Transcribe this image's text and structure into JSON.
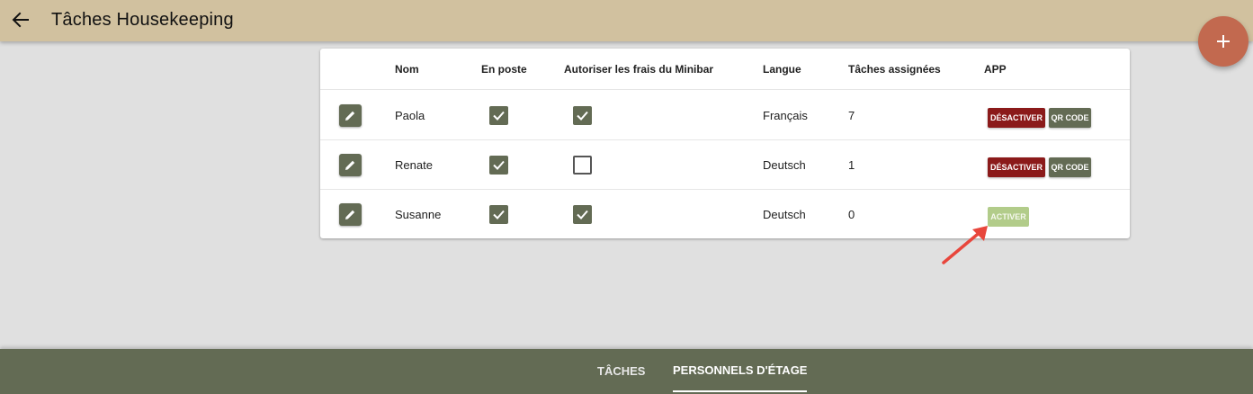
{
  "header": {
    "title": "Tâches Housekeeping",
    "back_icon": "arrow-left-icon",
    "add_icon": "plus-icon"
  },
  "table": {
    "columns": [
      "Nom",
      "En poste",
      "Autoriser les frais du Minibar",
      "Langue",
      "Tâches assignées",
      "APP"
    ],
    "rows": [
      {
        "name": "Paola",
        "on_duty": true,
        "minibar": true,
        "language": "Français",
        "tasks": "7",
        "actions": [
          "DÉSACTIVER",
          "QR CODE"
        ]
      },
      {
        "name": "Renate",
        "on_duty": true,
        "minibar": false,
        "language": "Deutsch",
        "tasks": "1",
        "actions": [
          "DÉSACTIVER",
          "QR CODE"
        ]
      },
      {
        "name": "Susanne",
        "on_duty": true,
        "minibar": true,
        "language": "Deutsch",
        "tasks": "0",
        "actions": [
          "ACTIVER"
        ]
      }
    ]
  },
  "tabs": [
    {
      "label": "TÂCHES",
      "active": false
    },
    {
      "label": "PERSONNELS D'ÉTAGE",
      "active": true
    }
  ],
  "colors": {
    "header_bg": "#d1c19f",
    "fab": "#c2694f",
    "olive": "#636b54",
    "deactivate": "#8b1a1a",
    "activate": "#b2cc8a",
    "annotation_arrow": "#e8463c"
  }
}
